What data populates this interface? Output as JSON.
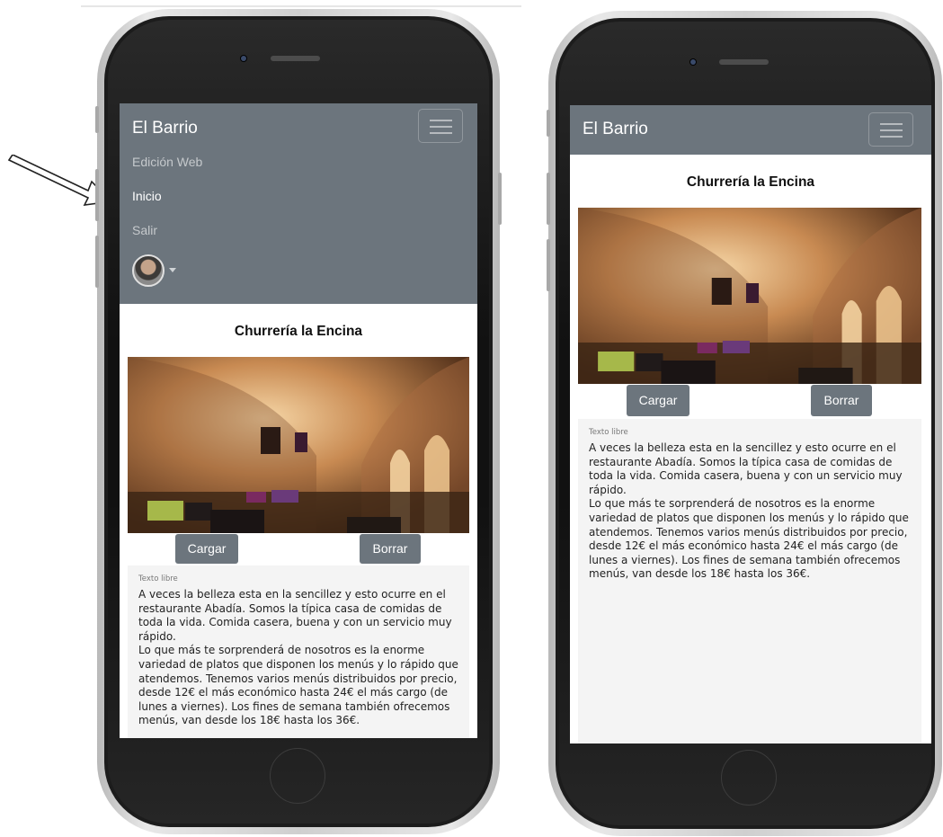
{
  "navbar": {
    "brand": "El Barrio",
    "menu": [
      "Edición Web",
      "Inicio",
      "Salir"
    ],
    "active_item": "Inicio",
    "bg_color": "#6c757d"
  },
  "content": {
    "title": "Churrería la Encina",
    "load_button": "Cargar",
    "delete_button": "Borrar",
    "text_label": "Texto libre",
    "text_body": "A veces la belleza esta en la sencillez y esto ocurre en el restaurante Abadía. Somos la típica casa de comidas de toda la vida. Comida casera, buena y con un servicio muy rápido.\nLo que más te sorprenderá de nosotros es la enorme variedad de platos que disponen los menús y lo rápido que atendemos. Tenemos varios menús distribuidos por precio, desde 12€ el más económico hasta 24€ el más cargo (de lunes a viernes).  Los fines de semana también ofrecemos menús, van desde los 18€ hasta los 36€."
  },
  "icons": {
    "menu_toggle": "hamburger-icon",
    "user": "user-avatar",
    "dropdown": "caret-down-icon",
    "pointer": "outline-arrow-icon"
  }
}
